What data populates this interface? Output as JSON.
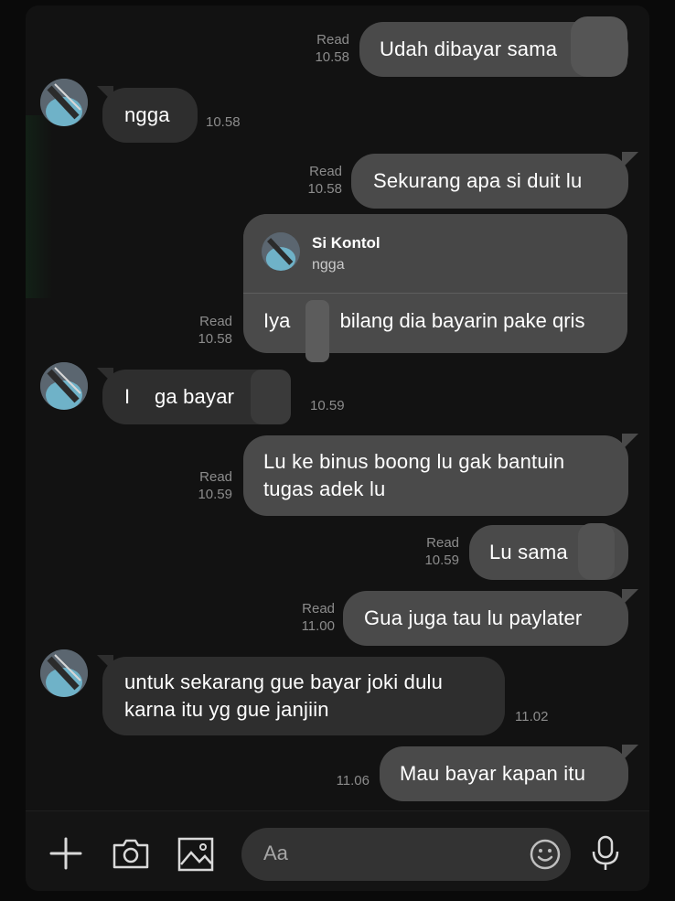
{
  "messages": [
    {
      "id": "m1",
      "side": "out",
      "text": "Udah dibayar sama",
      "read": "Read",
      "time": "10.58"
    },
    {
      "id": "m2",
      "side": "in",
      "text": "ngga",
      "time": "10.58"
    },
    {
      "id": "m3",
      "side": "out",
      "text": "Sekurang apa si duit lu",
      "read": "Read",
      "time": "10.58"
    },
    {
      "id": "m4",
      "side": "out",
      "reply_to": {
        "name": "Si Kontol",
        "text": "ngga"
      },
      "text_a": "Iya",
      "text_b": "bilang dia bayarin pake qris",
      "read": "Read",
      "time": "10.58"
    },
    {
      "id": "m5",
      "side": "in",
      "text_a": "I",
      "text_b": "ga bayar",
      "time": "10.59"
    },
    {
      "id": "m6",
      "side": "out",
      "lines": [
        "Lu ke binus boong lu gak bantuin",
        "tugas adek lu"
      ],
      "read": "Read",
      "time": "10.59"
    },
    {
      "id": "m7",
      "side": "out",
      "text": "Lu sama",
      "read": "Read",
      "time": "10.59"
    },
    {
      "id": "m8",
      "side": "out",
      "text": "Gua juga tau lu paylater",
      "read": "Read",
      "time": "11.00"
    },
    {
      "id": "m9",
      "side": "in",
      "lines": [
        "untuk sekarang gue bayar joki dulu",
        "karna itu yg gue janjiin"
      ],
      "time": "11.02"
    },
    {
      "id": "m10",
      "side": "out",
      "text": "Mau bayar kapan itu",
      "time": "11.06"
    }
  ],
  "input": {
    "placeholder": "Aa"
  },
  "icons": {
    "add": "plus-icon",
    "camera": "camera-icon",
    "gallery": "image-icon",
    "emoji": "smiley-icon",
    "mic": "microphone-icon"
  },
  "colors": {
    "background": "#121212",
    "outgoing_bubble": "#4a4a4a",
    "incoming_bubble": "#2e2e2e",
    "meta_text": "#8c8c8c",
    "input_bg": "#333333"
  }
}
